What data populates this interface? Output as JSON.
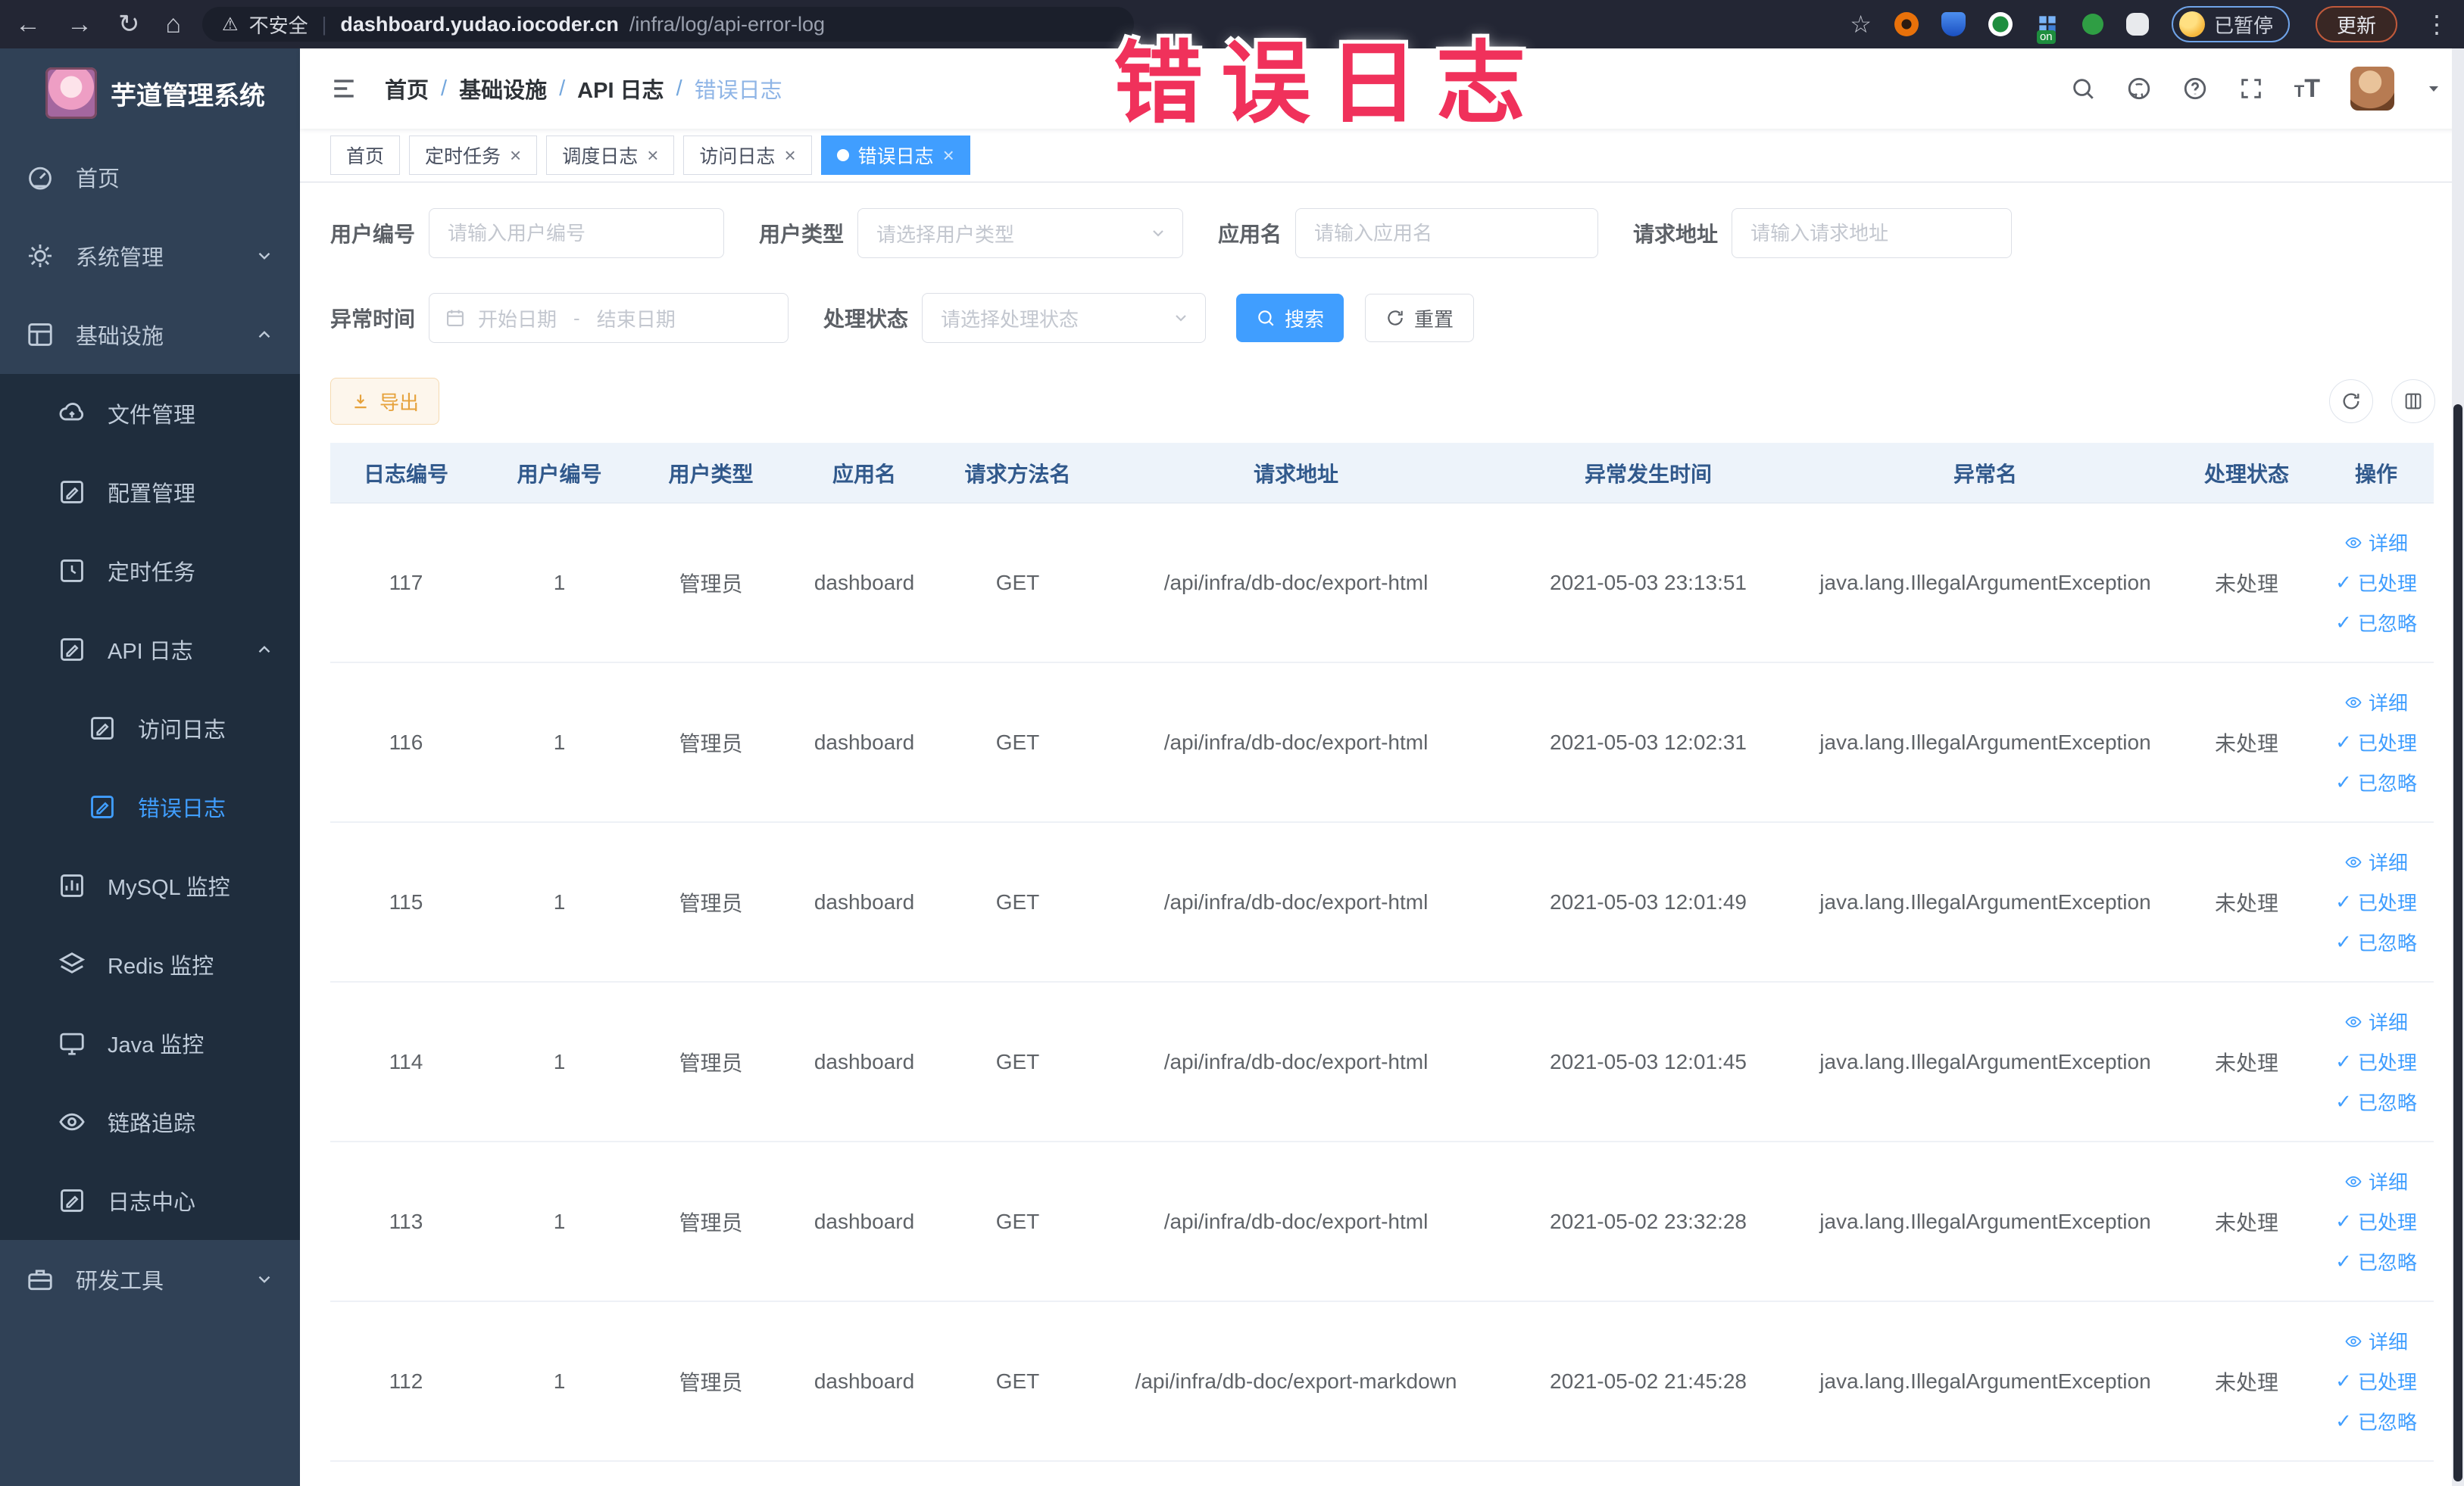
{
  "annotation": {
    "text": "错误日志",
    "color": "#f0315b"
  },
  "browser": {
    "security_label": "不安全",
    "url_host": "dashboard.yudao.iocoder.cn",
    "url_path": "/infra/log/api-error-log",
    "extension_badge": "on",
    "paused_label": "已暂停",
    "update_label": "更新"
  },
  "icons": {
    "back": "←",
    "forward": "→",
    "reload": "↻",
    "home": "⌂",
    "warning": "⚠",
    "star": "☆",
    "kebab": "⋮",
    "pipe": "|",
    "t_large": "T",
    "t_small": "T",
    "check": "✓",
    "close": "×"
  },
  "sidebar": {
    "logo_title": "芋道管理系统",
    "items": [
      {
        "label": "首页"
      },
      {
        "label": "系统管理"
      },
      {
        "label": "基础设施"
      },
      {
        "label": "文件管理"
      },
      {
        "label": "配置管理"
      },
      {
        "label": "定时任务"
      },
      {
        "label": "API 日志"
      },
      {
        "label": "访问日志"
      },
      {
        "label": "错误日志"
      },
      {
        "label": "MySQL 监控"
      },
      {
        "label": "Redis 监控"
      },
      {
        "label": "Java 监控"
      },
      {
        "label": "链路追踪"
      },
      {
        "label": "日志中心"
      },
      {
        "label": "研发工具"
      }
    ]
  },
  "breadcrumb": {
    "separator": "/",
    "items": [
      "首页",
      "基础设施",
      "API 日志",
      "错误日志"
    ]
  },
  "tabs": {
    "close": "×",
    "items": [
      {
        "label": "首页"
      },
      {
        "label": "定时任务"
      },
      {
        "label": "调度日志"
      },
      {
        "label": "访问日志"
      },
      {
        "label": "错误日志"
      }
    ]
  },
  "filters": {
    "user_id": {
      "label": "用户编号",
      "placeholder": "请输入用户编号"
    },
    "user_type": {
      "label": "用户类型",
      "placeholder": "请选择用户类型"
    },
    "app_name": {
      "label": "应用名",
      "placeholder": "请输入应用名"
    },
    "request_url": {
      "label": "请求地址",
      "placeholder": "请输入请求地址"
    },
    "exception_time": {
      "label": "异常时间",
      "start_placeholder": "开始日期",
      "separator": "-",
      "end_placeholder": "结束日期"
    },
    "process_status": {
      "label": "处理状态",
      "placeholder": "请选择处理状态"
    },
    "search_label": "搜索",
    "reset_label": "重置"
  },
  "toolbar": {
    "export_label": "导出"
  },
  "table": {
    "headers": [
      "日志编号",
      "用户编号",
      "用户类型",
      "应用名",
      "请求方法名",
      "请求地址",
      "异常发生时间",
      "异常名",
      "处理状态",
      "操作"
    ],
    "op_detail": "详细",
    "op_processed": "已处理",
    "op_ignored": "已忽略",
    "rows": [
      {
        "id": "117",
        "user_id": "1",
        "user_type": "管理员",
        "app": "dashboard",
        "method": "GET",
        "url": "/api/infra/db-doc/export-html",
        "time": "2021-05-03 23:13:51",
        "exception": "java.lang.IllegalArgumentException",
        "status": "未处理"
      },
      {
        "id": "116",
        "user_id": "1",
        "user_type": "管理员",
        "app": "dashboard",
        "method": "GET",
        "url": "/api/infra/db-doc/export-html",
        "time": "2021-05-03 12:02:31",
        "exception": "java.lang.IllegalArgumentException",
        "status": "未处理"
      },
      {
        "id": "115",
        "user_id": "1",
        "user_type": "管理员",
        "app": "dashboard",
        "method": "GET",
        "url": "/api/infra/db-doc/export-html",
        "time": "2021-05-03 12:01:49",
        "exception": "java.lang.IllegalArgumentException",
        "status": "未处理"
      },
      {
        "id": "114",
        "user_id": "1",
        "user_type": "管理员",
        "app": "dashboard",
        "method": "GET",
        "url": "/api/infra/db-doc/export-html",
        "time": "2021-05-03 12:01:45",
        "exception": "java.lang.IllegalArgumentException",
        "status": "未处理"
      },
      {
        "id": "113",
        "user_id": "1",
        "user_type": "管理员",
        "app": "dashboard",
        "method": "GET",
        "url": "/api/infra/db-doc/export-html",
        "time": "2021-05-02 23:32:28",
        "exception": "java.lang.IllegalArgumentException",
        "status": "未处理"
      },
      {
        "id": "112",
        "user_id": "1",
        "user_type": "管理员",
        "app": "dashboard",
        "method": "GET",
        "url": "/api/infra/db-doc/export-markdown",
        "time": "2021-05-02 21:45:28",
        "exception": "java.lang.IllegalArgumentException",
        "status": "未处理"
      }
    ]
  },
  "colors": {
    "accent": "#409eff",
    "sidebar_bg": "#304156",
    "submenu_bg": "#1f2d3d",
    "warning_button": "#e6a23c",
    "annotation": "#f0315b",
    "table_header_text": "#31598c"
  }
}
